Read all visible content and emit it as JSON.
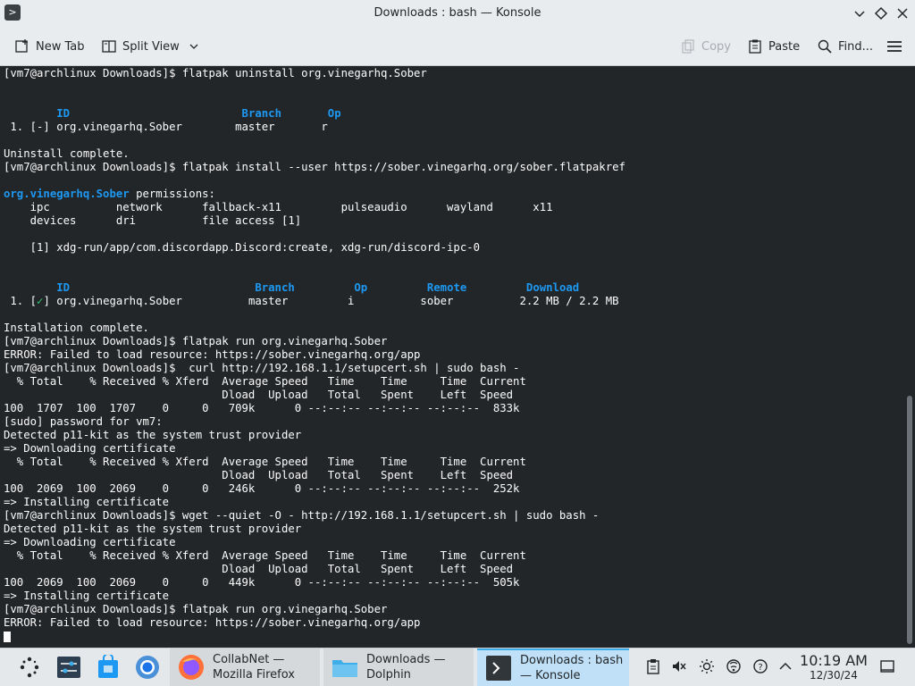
{
  "window": {
    "title": "Downloads : bash — Konsole",
    "app_icon_glyph": ">"
  },
  "toolbar": {
    "new_tab": "New Tab",
    "split_view": "Split View",
    "copy": "Copy",
    "paste": "Paste",
    "find": "Find..."
  },
  "terminal": {
    "lines": [
      "[vm7@archlinux Downloads]$ flatpak uninstall org.vinegarhq.Sober",
      "",
      "",
      "        ID                          Branch       Op",
      " 1. [-] org.vinegarhq.Sober        master       r",
      "",
      "Uninstall complete.",
      "[vm7@archlinux Downloads]$ flatpak install --user https://sober.vinegarhq.org/sober.flatpakref",
      "",
      "org.vinegarhq.Sober permissions:",
      "    ipc          network      fallback-x11         pulseaudio      wayland      x11",
      "    devices      dri          file access [1]",
      "",
      "    [1] xdg-run/app/com.discordapp.Discord:create, xdg-run/discord-ipc-0",
      "",
      "",
      "        ID                            Branch         Op         Remote         Download",
      " 1. [✓] org.vinegarhq.Sober          master         i          sober          2.2 MB / 2.2 MB",
      "",
      "Installation complete.",
      "[vm7@archlinux Downloads]$ flatpak run org.vinegarhq.Sober",
      "ERROR: Failed to load resource: https://sober.vinegarhq.org/app",
      "[vm7@archlinux Downloads]$  curl http://192.168.1.1/setupcert.sh | sudo bash -",
      "  % Total    % Received % Xferd  Average Speed   Time    Time     Time  Current",
      "                                 Dload  Upload   Total   Spent    Left  Speed",
      "100  1707  100  1707    0     0   709k      0 --:--:-- --:--:-- --:--:--  833k",
      "[sudo] password for vm7:",
      "Detected p11-kit as the system trust provider",
      "=> Downloading certificate",
      "  % Total    % Received % Xferd  Average Speed   Time    Time     Time  Current",
      "                                 Dload  Upload   Total   Spent    Left  Speed",
      "100  2069  100  2069    0     0   246k      0 --:--:-- --:--:-- --:--:--  252k",
      "=> Installing certificate",
      "[vm7@archlinux Downloads]$ wget --quiet -O - http://192.168.1.1/setupcert.sh | sudo bash -",
      "Detected p11-kit as the system trust provider",
      "=> Downloading certificate",
      "  % Total    % Received % Xferd  Average Speed   Time    Time     Time  Current",
      "                                 Dload  Upload   Total   Spent    Left  Speed",
      "100  2069  100  2069    0     0   449k      0 --:--:-- --:--:-- --:--:--  505k",
      "=> Installing certificate",
      "[vm7@archlinux Downloads]$ flatpak run org.vinegarhq.Sober",
      "ERROR: Failed to load resource: https://sober.vinegarhq.org/app",
      ""
    ],
    "highlight_color": "#1d99f3",
    "background_color": "#232629",
    "text_color": "#fcfcfc"
  },
  "taskbar": {
    "tasks": [
      {
        "line1": "CollabNet —",
        "line2": "Mozilla Firefox",
        "icon": "firefox-icon"
      },
      {
        "line1": "Downloads —",
        "line2": "Dolphin",
        "icon": "dolphin-icon"
      },
      {
        "line1": "Downloads : bash",
        "line2": "— Konsole",
        "icon": "konsole-icon"
      }
    ],
    "clock": {
      "time": "10:19 AM",
      "date": "12/30/24"
    },
    "accent_color": "#3daee9"
  }
}
